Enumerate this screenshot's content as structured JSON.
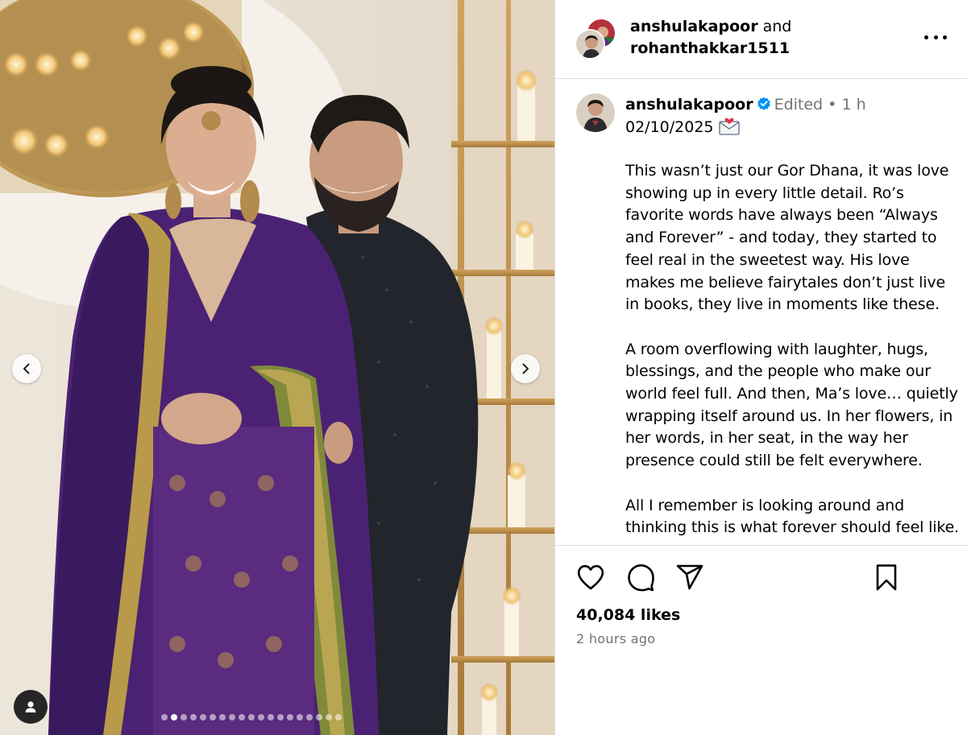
{
  "header": {
    "user_1": "anshulakapoor",
    "joiner": "and",
    "user_2": "rohanthakkar1511"
  },
  "caption": {
    "username": "anshulakapoor",
    "edited_label": "Edited",
    "separator": "•",
    "relative_time": "1 h",
    "date_line": "02/10/2025",
    "paragraphs": [
      "This wasn’t just our Gor Dhana, it was love showing up in every little detail. Ro’s favorite words have always been “Always and Forever” - and today, they started to feel real in the sweetest way. His love makes me believe fairytales don’t just live in books, they live in moments like these.",
      "A room overflowing with laughter, hugs, blessings, and the people who make our world feel full. And then, Ma’s love… quietly wrapping itself around us. In her flowers, in her words, in her seat, in the way her presence could still be felt everywhere.",
      "All I remember is looking around and thinking this is what forever should feel like."
    ]
  },
  "engagement": {
    "likes": "40,084 likes",
    "posted": "2 hours ago"
  },
  "carousel": {
    "slide_count": 19,
    "active_index": 1
  },
  "icons": {
    "like": "heart-icon",
    "comment": "comment-icon",
    "share": "paper-plane-icon",
    "save": "bookmark-icon",
    "more": "ellipsis-icon",
    "prev": "chevron-left-icon",
    "next": "chevron-right-icon",
    "tags": "user-tag-icon",
    "verified": "verified-badge-icon",
    "date_emoji": "love-letter-icon"
  },
  "colors": {
    "verified": "#0095f6",
    "secondary_text": "#737373",
    "divider": "#dbdbdb"
  }
}
